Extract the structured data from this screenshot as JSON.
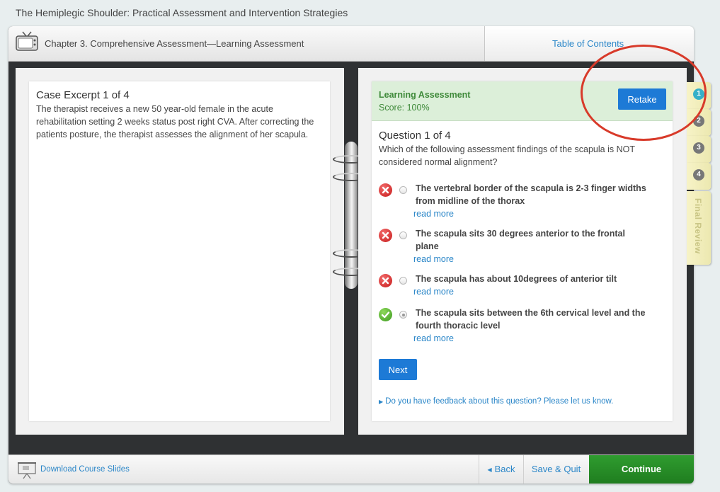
{
  "course_title": "The Hemiplegic Shoulder: Practical Assessment and Intervention Strategies",
  "header": {
    "chapter_title": "Chapter 3. Comprehensive Assessment—Learning Assessment",
    "toc_label": "Table of Contents",
    "icon": "tv-icon"
  },
  "case": {
    "title": "Case Excerpt 1 of 4",
    "text": "The therapist receives a new 50 year-old female in the acute rehabilitation setting 2 weeks status post right CVA. After correcting the patients posture, the therapist assesses the alignment of her scapula."
  },
  "assessment": {
    "label": "Learning Assessment",
    "score": "Score: 100%",
    "retake_label": "Retake"
  },
  "question": {
    "title": "Question 1 of 4",
    "text": "Which of the following assessment findings of the scapula is NOT considered normal alignment?",
    "answers": [
      {
        "text": "The vertebral border of the scapula is 2-3 finger widths from midline of the thorax",
        "more": "read more",
        "result": "incorrect",
        "selected": false
      },
      {
        "text": "The scapula sits 30 degrees anterior to the frontal plane",
        "more": "read more",
        "result": "incorrect",
        "selected": false
      },
      {
        "text": "The scapula has about 10degrees of anterior tilt",
        "more": "read more",
        "result": "incorrect",
        "selected": false
      },
      {
        "text": "The scapula sits between the 6th cervical level and the fourth thoracic level",
        "more": "read more",
        "result": "correct",
        "selected": true
      }
    ],
    "next_label": "Next",
    "feedback": "Do you have feedback about this question? Please let us know."
  },
  "side_tabs": {
    "numbers": [
      "1",
      "2",
      "3",
      "4"
    ],
    "active": "1",
    "final_review": "Final Review"
  },
  "footer": {
    "slides_label": "Download Course Slides",
    "back_label": "Back",
    "save_label": "Save & Quit",
    "continue_label": "Continue"
  },
  "colors": {
    "accent_blue": "#1d7ad6",
    "link_blue": "#2a86c8",
    "success_green": "#3f8a3a",
    "continue_green": "#2f9c2f",
    "annotation_red": "#d83a2a"
  }
}
